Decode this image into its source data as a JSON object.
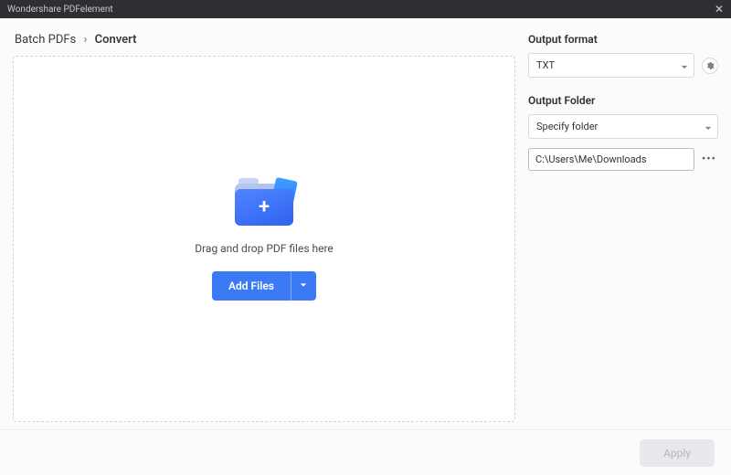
{
  "window": {
    "title": "Wondershare PDFelement"
  },
  "breadcrumb": {
    "root": "Batch PDFs",
    "current": "Convert",
    "separator": "›"
  },
  "dropzone": {
    "instruction": "Drag and drop PDF files here",
    "add_files_label": "Add Files"
  },
  "panel": {
    "format_label": "Output format",
    "format_value": "TXT",
    "folder_label": "Output Folder",
    "folder_mode": "Specify folder",
    "folder_path": "C:\\Users\\Me\\Downloads"
  },
  "footer": {
    "apply_label": "Apply"
  }
}
